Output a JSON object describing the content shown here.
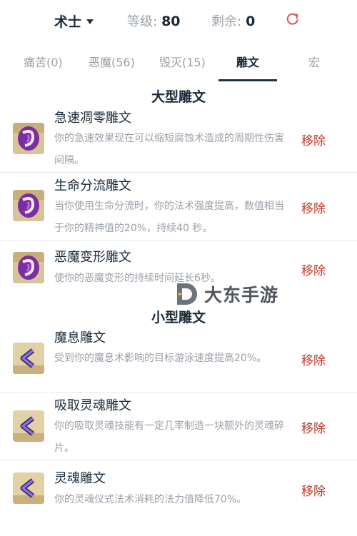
{
  "header": {
    "class_name": "术士",
    "level_label": "等级:",
    "level_value": "80",
    "remaining_label": "剩余:",
    "remaining_value": "0"
  },
  "tabs": [
    {
      "label": "痛苦(0)",
      "active": false
    },
    {
      "label": "恶魔(56)",
      "active": false
    },
    {
      "label": "毁灭(15)",
      "active": false
    },
    {
      "label": "雕文",
      "active": true
    },
    {
      "label": "宏",
      "active": false
    }
  ],
  "major_section": {
    "title": "大型雕文",
    "items": [
      {
        "name": "急速凋零雕文",
        "desc": "你的急速效果现在可以缩短腐蚀术造成的周期性伤害间隔。",
        "remove": "移除",
        "icon": "purple-rune-icon"
      },
      {
        "name": "生命分流雕文",
        "desc": "当你使用生命分流时，你的法术强度提高，数值相当于你的精神值的20%，持续40 秒。",
        "remove": "移除",
        "icon": "purple-rune-icon"
      },
      {
        "name": "恶魔变形雕文",
        "desc": "使你的恶魔变形的持续时间延长6秒。",
        "remove": "移除",
        "icon": "purple-rune-icon"
      }
    ]
  },
  "minor_section": {
    "title": "小型雕文",
    "items": [
      {
        "name": "魔息雕文",
        "desc": "受到你的魔息术影响的目标游泳速度提高20%。",
        "remove": "移除",
        "icon": "arrow-rune-icon"
      },
      {
        "name": "吸取灵魂雕文",
        "desc": "你的吸取灵魂技能有一定几率制造一块额外的灵魂碎片。",
        "remove": "移除",
        "icon": "arrow-rune-icon"
      },
      {
        "name": "灵魂雕文",
        "desc": "你的灵魂仪式法术消耗的法力值降低70%。",
        "remove": "移除",
        "icon": "arrow-rune-icon"
      }
    ]
  },
  "watermark": {
    "text": "大东手游"
  },
  "colors": {
    "accent": "#1f3346",
    "remove": "#c0392b",
    "muted": "#9aa0a8",
    "text": "#1a2a3a"
  }
}
